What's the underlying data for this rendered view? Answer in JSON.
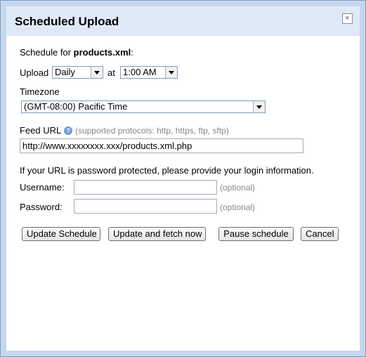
{
  "dialog": {
    "title": "Scheduled Upload",
    "close_label": "×"
  },
  "schedule": {
    "prefix": "Schedule for",
    "filename": "products.xml",
    "suffix": ":"
  },
  "upload": {
    "label": "Upload",
    "frequency": "Daily",
    "at_label": "at",
    "time": "1:00 AM"
  },
  "timezone": {
    "label": "Timezone",
    "value": "(GMT-08:00) Pacific Time"
  },
  "feed_url": {
    "label": "Feed URL",
    "help_icon": "?",
    "hint": "(supported protocols: http, https, ftp, sftp)",
    "value": "http://www.xxxxxxxx.xxx/products.xml.php"
  },
  "auth": {
    "notice": "If your URL is password protected, please provide your login information.",
    "username_label": "Username:",
    "password_label": "Password:",
    "optional": "(optional)",
    "username_value": "",
    "password_value": ""
  },
  "buttons": {
    "update_schedule": "Update Schedule",
    "update_fetch": "Update and fetch now",
    "pause": "Pause schedule",
    "cancel": "Cancel"
  }
}
